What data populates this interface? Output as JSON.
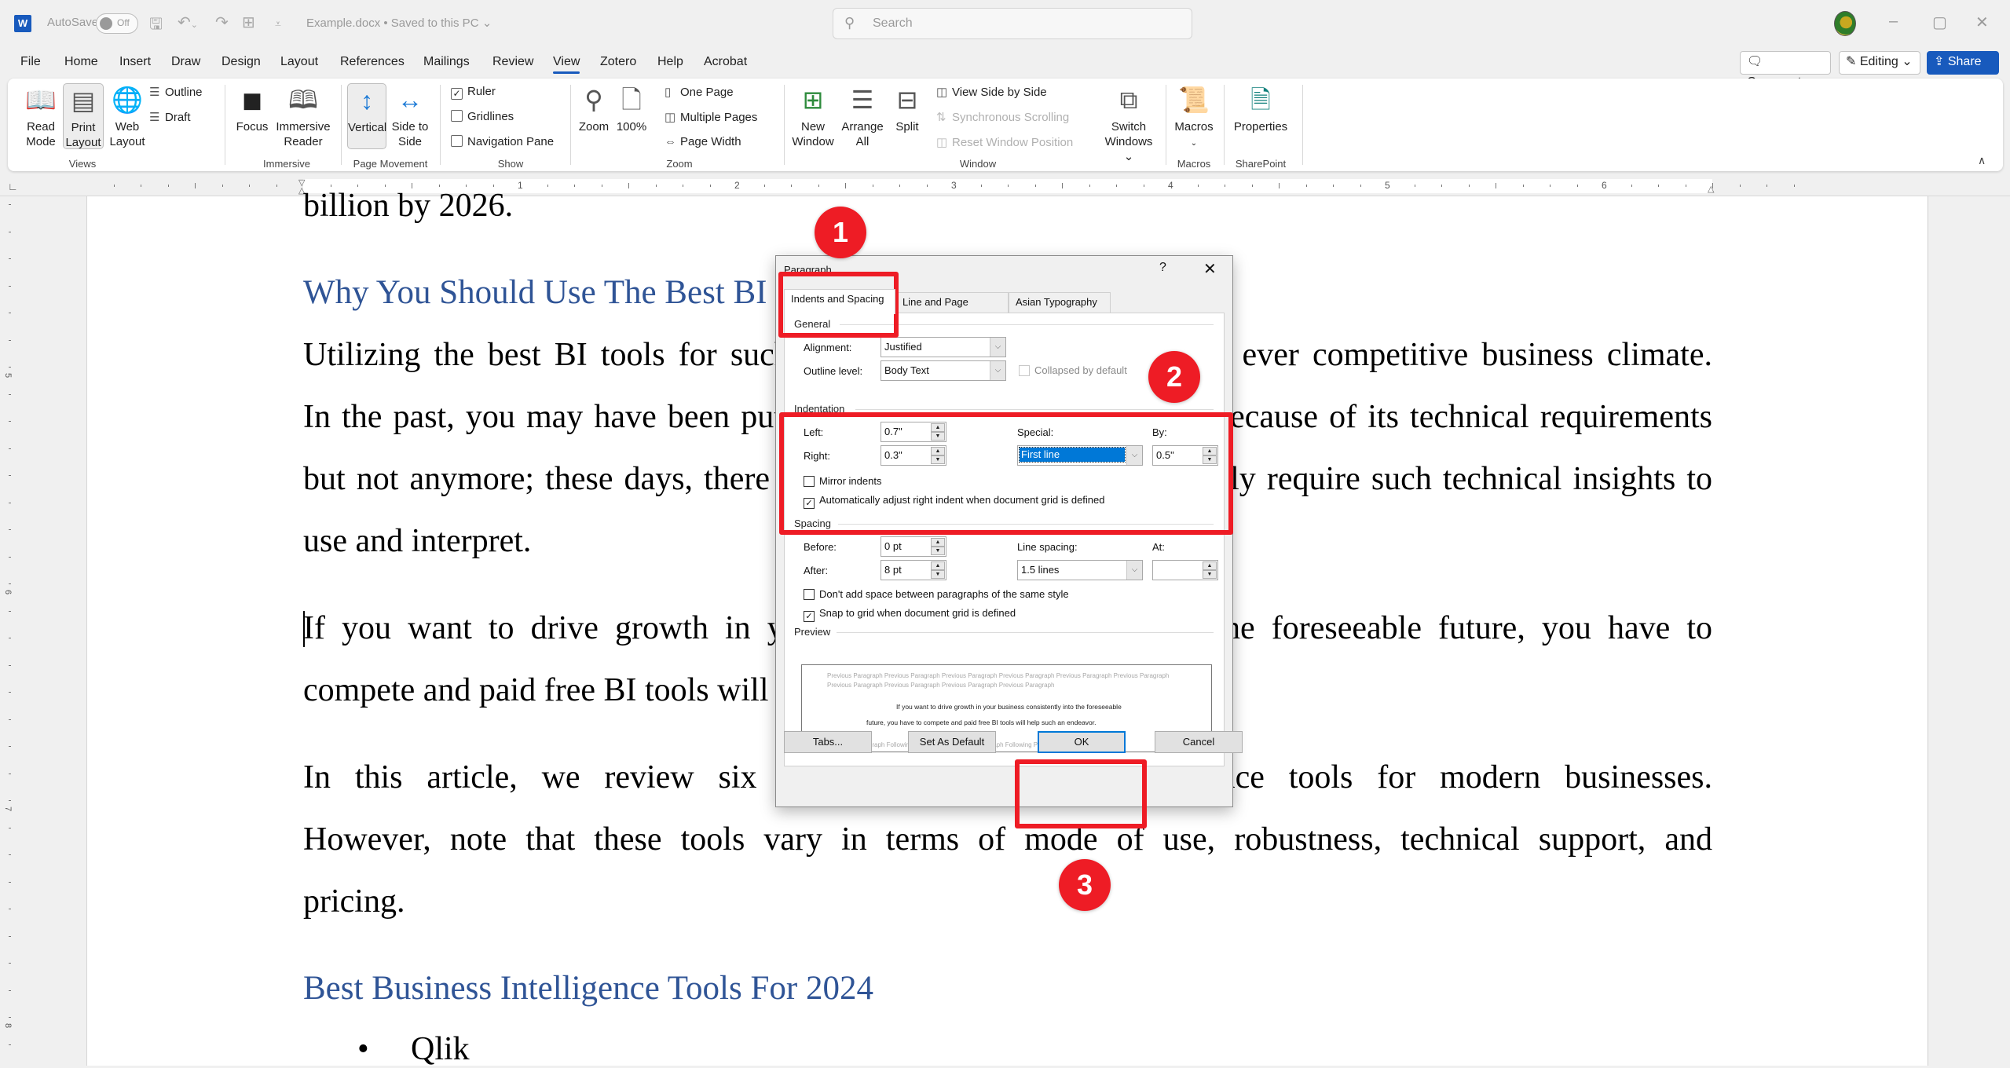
{
  "titlebar": {
    "app_icon": "W",
    "autosave_label": "AutoSave",
    "autosave_state": "Off",
    "doc_title": "Example.docx • Saved to this PC ⌄",
    "search_placeholder": "Search",
    "icons": [
      "save-icon",
      "undo-icon",
      "redo-icon",
      "table-icon",
      "customize-icon"
    ],
    "window_controls": {
      "minimize": "–",
      "restore": "▢",
      "close": "✕"
    }
  },
  "menu": {
    "tabs": [
      "File",
      "Home",
      "Insert",
      "Draw",
      "Design",
      "Layout",
      "References",
      "Mailings",
      "Review",
      "View",
      "Zotero",
      "Help",
      "Acrobat"
    ],
    "active_tab": "View",
    "comments_label": "Comments",
    "editing_label": "Editing ⌄",
    "share_label": "Share ⌄"
  },
  "ribbon": {
    "views": {
      "label": "Views",
      "read_mode": "Read Mode",
      "print_layout": "Print Layout",
      "web_layout": "Web Layout",
      "outline": "Outline",
      "draft": "Draft"
    },
    "immersive": {
      "label": "Immersive",
      "focus": "Focus",
      "immersive_reader": "Immersive Reader"
    },
    "page_movement": {
      "label": "Page Movement",
      "vertical": "Vertical",
      "side_to_side": "Side to Side"
    },
    "show": {
      "label": "Show",
      "ruler": "Ruler",
      "ruler_checked": true,
      "gridlines": "Gridlines",
      "gridlines_checked": false,
      "navigation_pane": "Navigation Pane",
      "navigation_pane_checked": false
    },
    "zoom": {
      "label": "Zoom",
      "zoom": "Zoom",
      "hundred": "100%",
      "one_page": "One Page",
      "multiple_pages": "Multiple Pages",
      "page_width": "Page Width"
    },
    "window": {
      "label": "Window",
      "new_window": "New Window",
      "arrange_all": "Arrange All",
      "split": "Split",
      "view_side_by_side": "View Side by Side",
      "synchronous_scrolling": "Synchronous Scrolling",
      "reset_window_position": "Reset Window Position",
      "switch_windows": "Switch Windows ⌄"
    },
    "macros": {
      "label": "Macros",
      "macros": "Macros"
    },
    "sharepoint": {
      "label": "SharePoint",
      "properties": "Properties"
    }
  },
  "ruler": {
    "h_numbers": [
      "1",
      "2",
      "3",
      "4",
      "5",
      "6"
    ],
    "v_numbers": [
      "5",
      "6",
      "7",
      "8"
    ]
  },
  "document": {
    "lines": [
      {
        "text": "billion by 2026.",
        "style": "body"
      },
      {
        "text": "Why You Should Use The Best BI Tools",
        "style": "heading"
      },
      {
        "text": "Utilizing the best BI tools for such purposes is essential in today's ever competitive business climate.",
        "style": "just"
      },
      {
        "text": "In the past, you may have been put off using business intelligence because of its technical requirements",
        "style": "just"
      },
      {
        "text": "but not anymore; these days, there are BI tools that do not necessarily require such technical insights to",
        "style": "just"
      },
      {
        "text": "use and interpret.",
        "style": "body"
      },
      {
        "text": "If you want to drive growth in your business consistently into the foreseeable future, you have to",
        "style": "just"
      },
      {
        "text": "compete and paid free BI tools will help such an endeavor.",
        "style": "body"
      },
      {
        "text": "In this article, we review six of the best business intelligence tools for modern businesses.",
        "style": "just"
      },
      {
        "text": "However, note that these tools vary in terms of mode of use, robustness, technical support, and",
        "style": "just"
      },
      {
        "text": "pricing.",
        "style": "body"
      },
      {
        "text": "Best Business Intelligence Tools For 2024",
        "style": "heading"
      }
    ],
    "bullet": "Qlik",
    "heading_color": "#2f5496"
  },
  "dialog": {
    "title": "Paragraph",
    "help": "?",
    "close": "✕",
    "tabs": [
      "Indents and Spacing",
      "Line and Page Breaks",
      "Asian Typography"
    ],
    "active_tab": "Indents and Spacing",
    "general": {
      "section": "General",
      "alignment_label": "Alignment:",
      "alignment_value": "Justified",
      "outline_label": "Outline level:",
      "outline_value": "Body Text",
      "collapsed_label": "Collapsed by default",
      "collapsed_checked": false
    },
    "indentation": {
      "section": "Indentation",
      "left_label": "Left:",
      "left_value": "0.7\"",
      "right_label": "Right:",
      "right_value": "0.3\"",
      "special_label": "Special:",
      "special_value": "First line",
      "by_label": "By:",
      "by_value": "0.5\"",
      "mirror_label": "Mirror indents",
      "mirror_checked": false,
      "auto_adjust_label": "Automatically adjust right indent when document grid is defined",
      "auto_adjust_checked": true
    },
    "spacing": {
      "section": "Spacing",
      "before_label": "Before:",
      "before_value": "0 pt",
      "after_label": "After:",
      "after_value": "8 pt",
      "line_spacing_label": "Line spacing:",
      "line_spacing_value": "1.5 lines",
      "at_label": "At:",
      "at_value": "",
      "dont_add_label": "Don't add space between paragraphs of the same style",
      "dont_add_checked": false,
      "snap_label": "Snap to grid when document grid is defined",
      "snap_checked": true
    },
    "preview": {
      "section": "Preview",
      "previous": "Previous Paragraph Previous Paragraph Previous Paragraph Previous Paragraph Previous Paragraph Previous Paragraph Previous Paragraph Previous Paragraph Previous Paragraph Previous Paragraph",
      "current_1": "If you want to drive growth in your business consistently into the foreseeable",
      "current_2": "future, you have to compete and paid free BI tools will help such an endeavor.",
      "following": "Following Paragraph Following Paragraph Following Paragraph Following Paragraph Following Paragraph"
    },
    "buttons": {
      "tabs": "Tabs...",
      "set_default": "Set As Default",
      "ok": "OK",
      "cancel": "Cancel"
    }
  },
  "annotations": {
    "color": "#ee1c25",
    "badges": [
      "1",
      "2",
      "3"
    ]
  }
}
